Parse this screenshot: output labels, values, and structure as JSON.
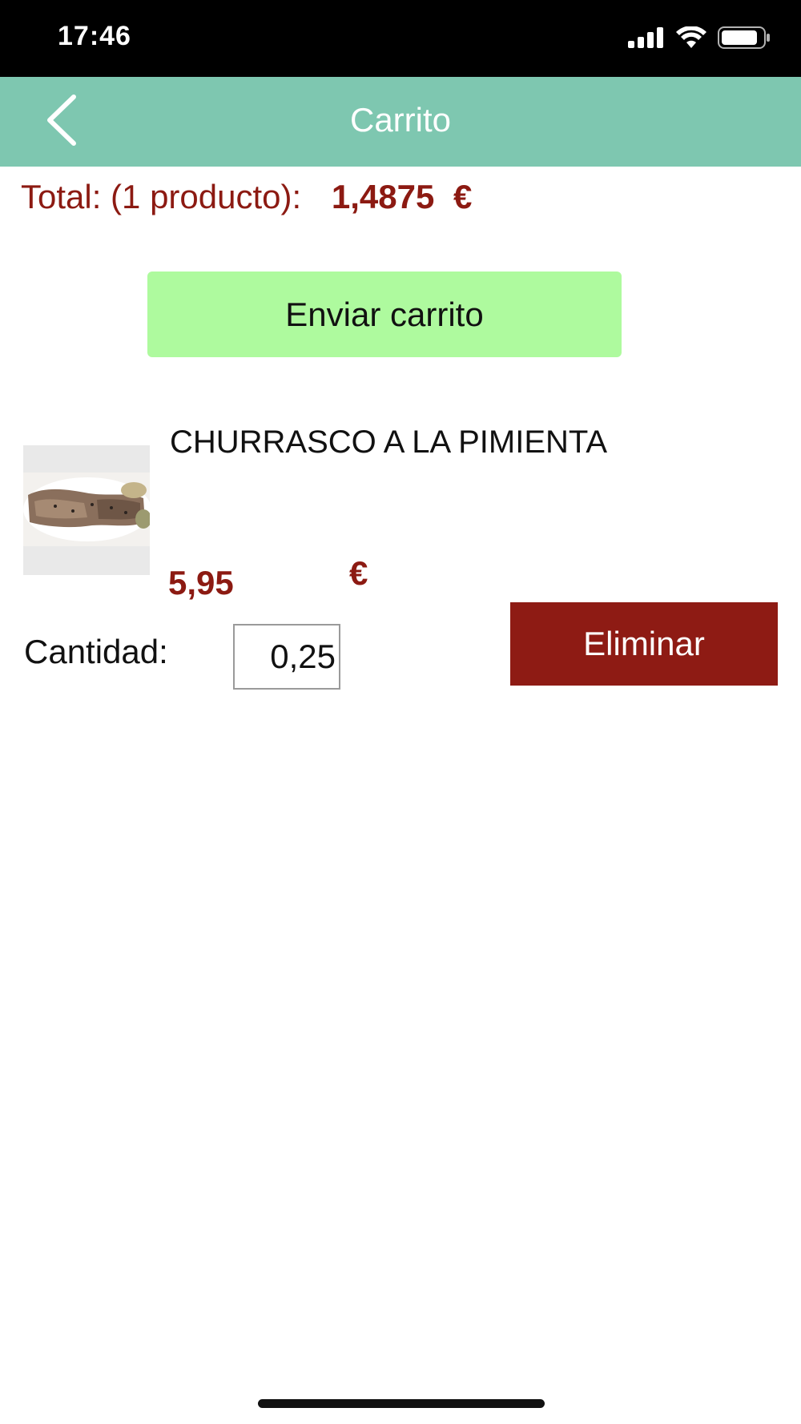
{
  "status_bar": {
    "time": "17:46",
    "icons": [
      "cellular-signal-icon",
      "wifi-icon",
      "battery-icon"
    ]
  },
  "nav": {
    "title": "Carrito",
    "back_icon": "chevron-left-icon",
    "background": "#7ec7b0"
  },
  "summary": {
    "total_label": "Total: (1 producto):",
    "total_value": "1,4875",
    "currency": "€"
  },
  "send_button": {
    "label": "Enviar carrito",
    "background": "#aefa9e"
  },
  "cart_items": [
    {
      "name": "CHURRASCO A LA PIMIENTA",
      "price": "5,95",
      "currency": "€",
      "quantity_label": "Cantidad:",
      "quantity_value": "0,25",
      "delete_label": "Eliminar"
    }
  ],
  "colors": {
    "accent_red": "#8c1a12",
    "delete_button": "#8e1b14"
  }
}
